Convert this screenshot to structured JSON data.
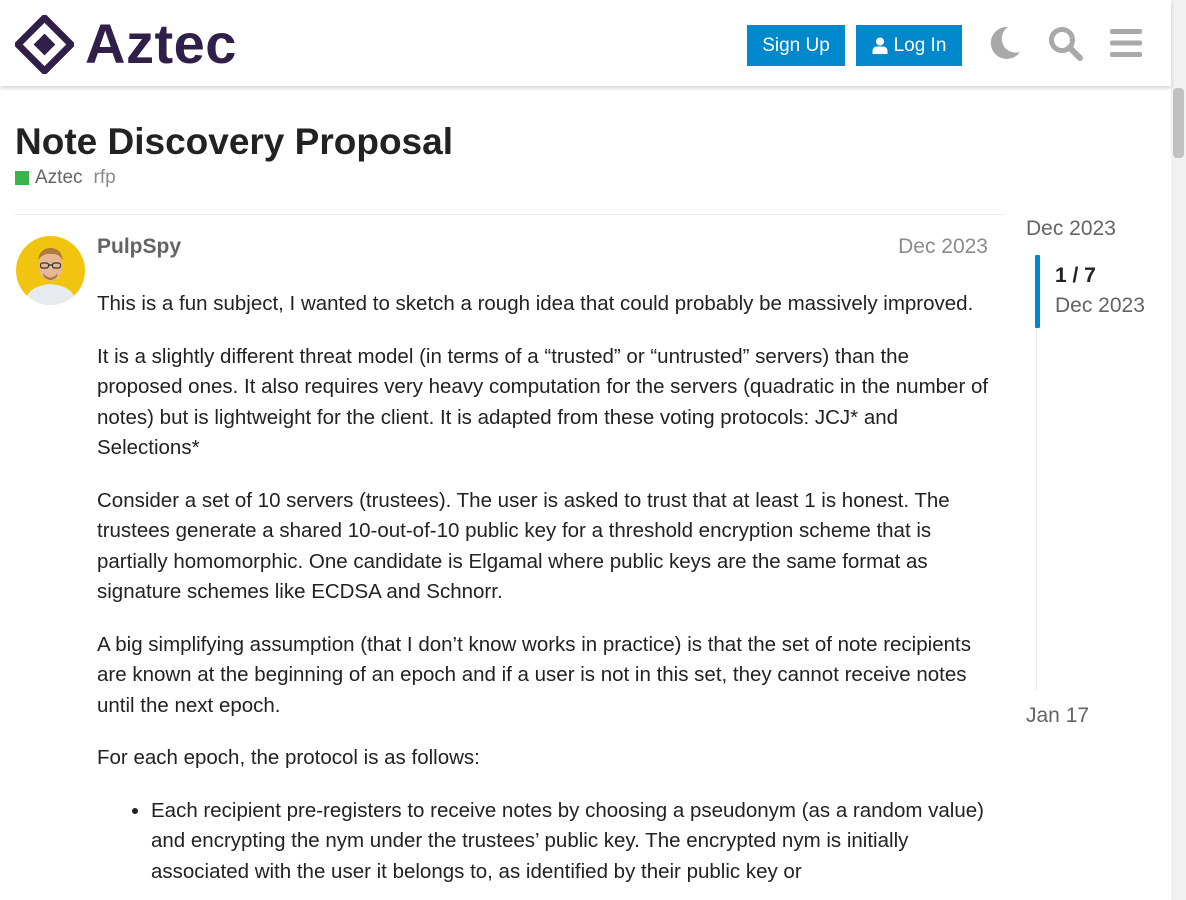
{
  "header": {
    "logo_text": "Aztec",
    "sign_up_label": "Sign Up",
    "log_in_label": "Log In",
    "icons": [
      "dark-mode-icon",
      "search-icon",
      "hamburger-menu-icon"
    ]
  },
  "topic": {
    "title": "Note Discovery Proposal",
    "category": "Aztec",
    "category_color": "#3ab54a",
    "tag": "rfp"
  },
  "post": {
    "username": "PulpSpy",
    "date": "Dec 2023",
    "paragraphs": [
      "This is a fun subject, I wanted to sketch a rough idea that could probably be massively improved.",
      "It is a slightly different threat model (in terms of a “trusted” or “untrusted” servers) than the proposed ones. It also requires very heavy computation for the servers (quadratic in the number of notes) but is lightweight for the client. It is adapted from these voting protocols: JCJ* and Selections*",
      "Consider a set of 10 servers (trustees). The user is asked to trust that at least 1 is honest. The trustees generate a shared 10-out-of-10 public key for a threshold encryption scheme that is partially homomorphic. One candidate is Elgamal where public keys are the same format as signature schemes like ECDSA and Schnorr.",
      "A big simplifying assumption (that I don’t know works in practice) is that the set of note recipients are known at the beginning of an epoch and if a user is not in this set, they cannot receive notes until the next epoch.",
      "For each epoch, the protocol is as follows:"
    ],
    "list_items": [
      "Each recipient pre-registers to receive notes by choosing a pseudonym (as a random value) and encrypting the nym under the trustees’ public key. The encrypted nym is initially associated with the user it belongs to, as identified by their public key or"
    ]
  },
  "timeline": {
    "start_date": "Dec 2023",
    "position": "1 / 7",
    "current_date": "Dec 2023",
    "end_date": "Jan 17"
  },
  "colors": {
    "accent": "#0088cc",
    "logo": "#2f1f49",
    "header_icon": "#a9a9a9"
  }
}
